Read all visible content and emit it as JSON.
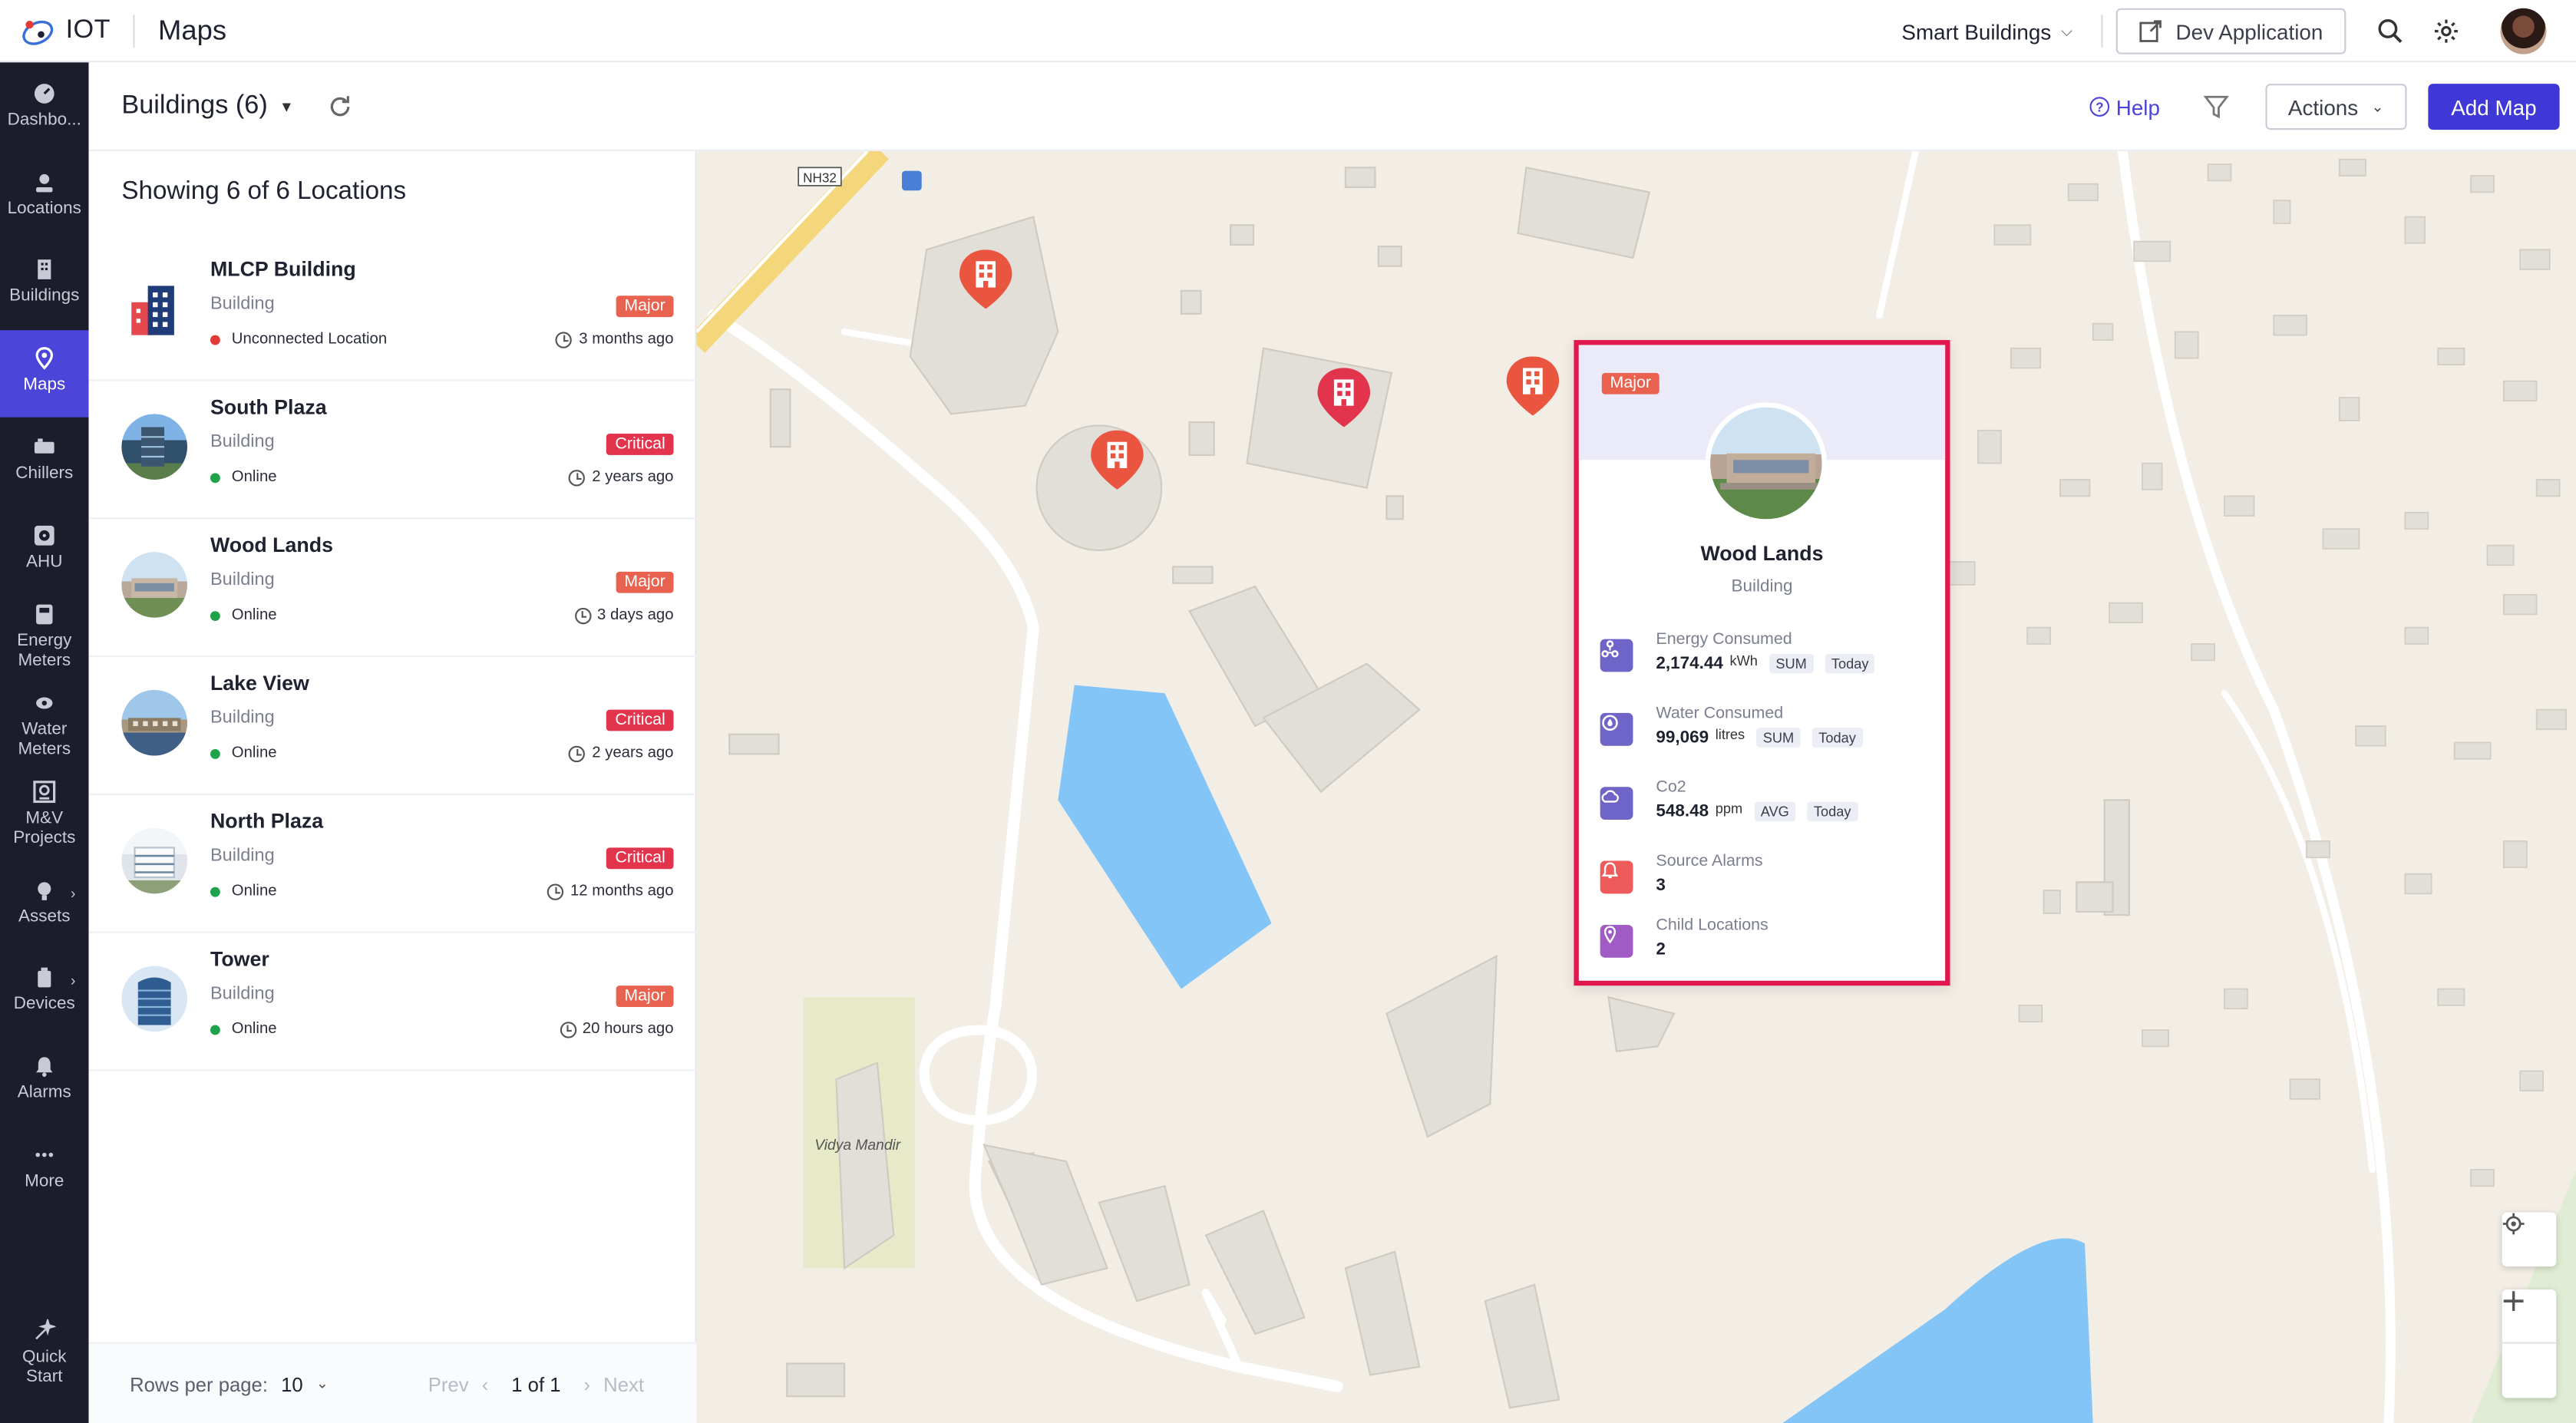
{
  "app": {
    "brand": "IOT",
    "module": "Maps"
  },
  "topbar": {
    "workspace": "Smart Buildings",
    "dev_app_label": "Dev Application",
    "search_icon": "search-icon",
    "settings_icon": "gear-icon"
  },
  "nav": [
    {
      "label": "Dashbo...",
      "icon": "dashboard-icon"
    },
    {
      "label": "Locations",
      "icon": "locations-icon"
    },
    {
      "label": "Buildings",
      "icon": "building-icon"
    },
    {
      "label": "Maps",
      "icon": "map-pin-icon",
      "active": true
    },
    {
      "label": "Chillers",
      "icon": "chiller-icon"
    },
    {
      "label": "AHU",
      "icon": "ahu-icon"
    },
    {
      "label": "Energy Meters",
      "icon": "energy-meter-icon"
    },
    {
      "label": "Water Meters",
      "icon": "water-meter-icon"
    },
    {
      "label": "M&V Projects",
      "icon": "mv-projects-icon"
    },
    {
      "label": "Assets",
      "icon": "assets-icon"
    },
    {
      "label": "Devices",
      "icon": "devices-icon"
    },
    {
      "label": "Alarms",
      "icon": "bell-icon"
    },
    {
      "label": "More",
      "icon": "more-icon"
    },
    {
      "label": "Quick Start",
      "icon": "quick-start-icon"
    }
  ],
  "subheader": {
    "title": "Buildings (6)",
    "help_label": "Help",
    "actions_label": "Actions",
    "add_map_label": "Add Map"
  },
  "list": {
    "heading": "Showing 6 of 6 Locations",
    "items": [
      {
        "name": "MLCP Building",
        "type": "Building",
        "status": "Unconnected Location",
        "status_color": "#e53935",
        "severity": "Major",
        "time": "3 months ago"
      },
      {
        "name": "South Plaza",
        "type": "Building",
        "status": "Online",
        "status_color": "#1fa34a",
        "severity": "Critical",
        "time": "2 years ago"
      },
      {
        "name": "Wood Lands",
        "type": "Building",
        "status": "Online",
        "status_color": "#1fa34a",
        "severity": "Major",
        "time": "3 days ago"
      },
      {
        "name": "Lake View",
        "type": "Building",
        "status": "Online",
        "status_color": "#1fa34a",
        "severity": "Critical",
        "time": "2 years ago"
      },
      {
        "name": "North Plaza",
        "type": "Building",
        "status": "Online",
        "status_color": "#1fa34a",
        "severity": "Critical",
        "time": "12 months ago"
      },
      {
        "name": "Tower",
        "type": "Building",
        "status": "Online",
        "status_color": "#1fa34a",
        "severity": "Major",
        "time": "20 hours ago"
      }
    ],
    "footer": {
      "rows_label": "Rows per page:",
      "rows_value": "10",
      "prev": "Prev",
      "page": "1 of 1",
      "next": "Next"
    }
  },
  "map": {
    "road_label": "NH32",
    "place_label": "Vidya Mandir",
    "popup": {
      "severity": "Major",
      "name": "Wood Lands",
      "type": "Building",
      "metrics": [
        {
          "label": "Energy Consumed",
          "value": "2,174.44",
          "unit": "kWh",
          "agg": "SUM",
          "period": "Today",
          "icon": "energy-icon",
          "color": "#6f65c9"
        },
        {
          "label": "Water Consumed",
          "value": "99,069",
          "unit": "litres",
          "agg": "SUM",
          "period": "Today",
          "icon": "water-icon",
          "color": "#6f65c9"
        },
        {
          "label": "Co2",
          "value": "548.48",
          "unit": "ppm",
          "agg": "AVG",
          "period": "Today",
          "icon": "co2-icon",
          "color": "#6f65c9"
        },
        {
          "label": "Source Alarms",
          "value": "3",
          "icon": "alarm-bell-icon",
          "color": "#ef5a5a"
        },
        {
          "label": "Child Locations",
          "value": "2",
          "icon": "location-pin-icon",
          "color": "#a05cc4"
        }
      ]
    }
  },
  "colors": {
    "accent": "#4038d6",
    "nav_bg": "#1b1d2a",
    "major": "#e8624f",
    "critical": "#e2344d",
    "popup_border": "#e0184e",
    "water": "#84c5f8"
  }
}
